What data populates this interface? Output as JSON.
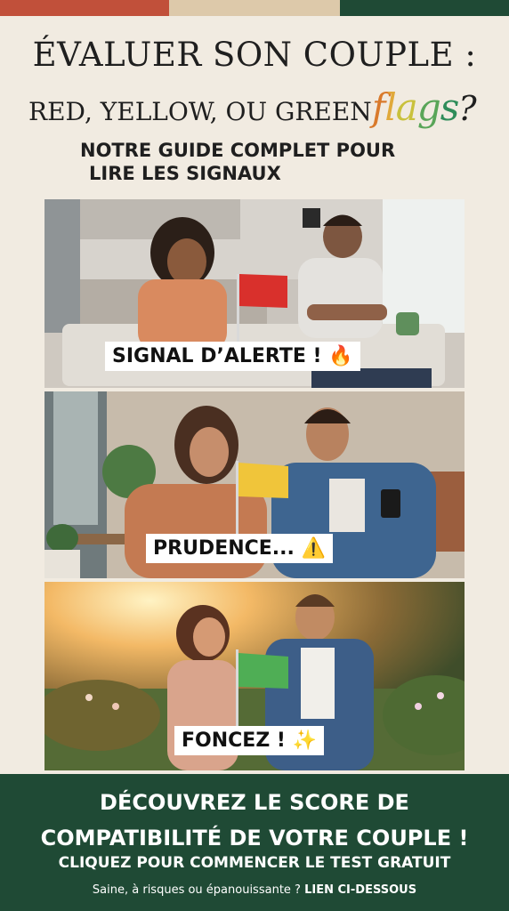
{
  "colors": {
    "background": "#f1ebe1",
    "topbar": [
      "#c1503a",
      "#ddc9aa",
      "#1f4a35"
    ],
    "footer": "#1f4a35",
    "red_flag": "#d9302c",
    "yellow_flag": "#f0c53a",
    "green_flag": "#4fae55"
  },
  "header": {
    "title_line1": "ÉVALUER SON COUPLE :",
    "title_line2": "RED, YELLOW, OU GREEN",
    "title_flags_letters": [
      "f",
      "l",
      "a",
      "g",
      "s"
    ],
    "title_question_mark": "?",
    "subtitle_line1": "NOTRE GUIDE COMPLET POUR",
    "subtitle_line2": "LIRE LES SIGNAUX"
  },
  "panels": [
    {
      "label": "SIGNAL D’ALERTE !",
      "emoji": "🔥",
      "flag_icon": "red-flag-icon"
    },
    {
      "label": "PRUDENCE...",
      "emoji": "⚠️",
      "flag_icon": "yellow-flag-icon"
    },
    {
      "label": "FONCEZ !",
      "emoji": "✨",
      "flag_icon": "green-flag-icon"
    }
  ],
  "footer": {
    "headline_line1": "DÉCOUVREZ LE SCORE DE",
    "headline_line2": "COMPATIBILITÉ DE VOTRE COUPLE !",
    "cta": "CLIQUEZ POUR COMMENCER LE TEST GRATUIT",
    "tagline_prefix": "Saine, à risques ou épanouissante ?",
    "tagline_link": "LIEN CI-DESSOUS"
  }
}
